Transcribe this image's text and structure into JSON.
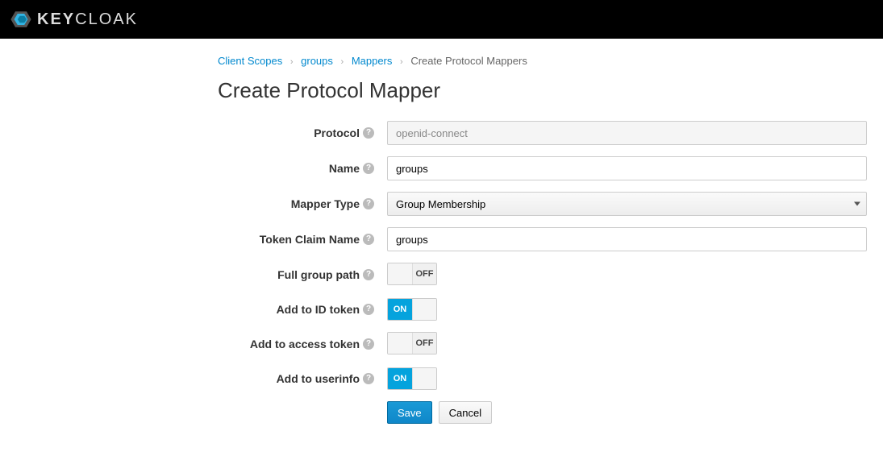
{
  "brand": {
    "name_bold": "KEY",
    "name_light": "CLOAK"
  },
  "breadcrumb": {
    "items": [
      {
        "label": "Client Scopes",
        "link": true
      },
      {
        "label": "groups",
        "link": true
      },
      {
        "label": "Mappers",
        "link": true
      },
      {
        "label": "Create Protocol Mappers",
        "link": false
      }
    ]
  },
  "page": {
    "title": "Create Protocol Mapper"
  },
  "form": {
    "protocol": {
      "label": "Protocol",
      "value": "openid-connect"
    },
    "name": {
      "label": "Name",
      "value": "groups"
    },
    "mapper_type": {
      "label": "Mapper Type",
      "value": "Group Membership"
    },
    "token_claim_name": {
      "label": "Token Claim Name",
      "value": "groups"
    },
    "full_group_path": {
      "label": "Full group path",
      "on": false
    },
    "add_to_id_token": {
      "label": "Add to ID token",
      "on": true
    },
    "add_to_access_token": {
      "label": "Add to access token",
      "on": false
    },
    "add_to_userinfo": {
      "label": "Add to userinfo",
      "on": true
    },
    "toggle_labels": {
      "on": "ON",
      "off": "OFF"
    }
  },
  "buttons": {
    "save": "Save",
    "cancel": "Cancel"
  }
}
